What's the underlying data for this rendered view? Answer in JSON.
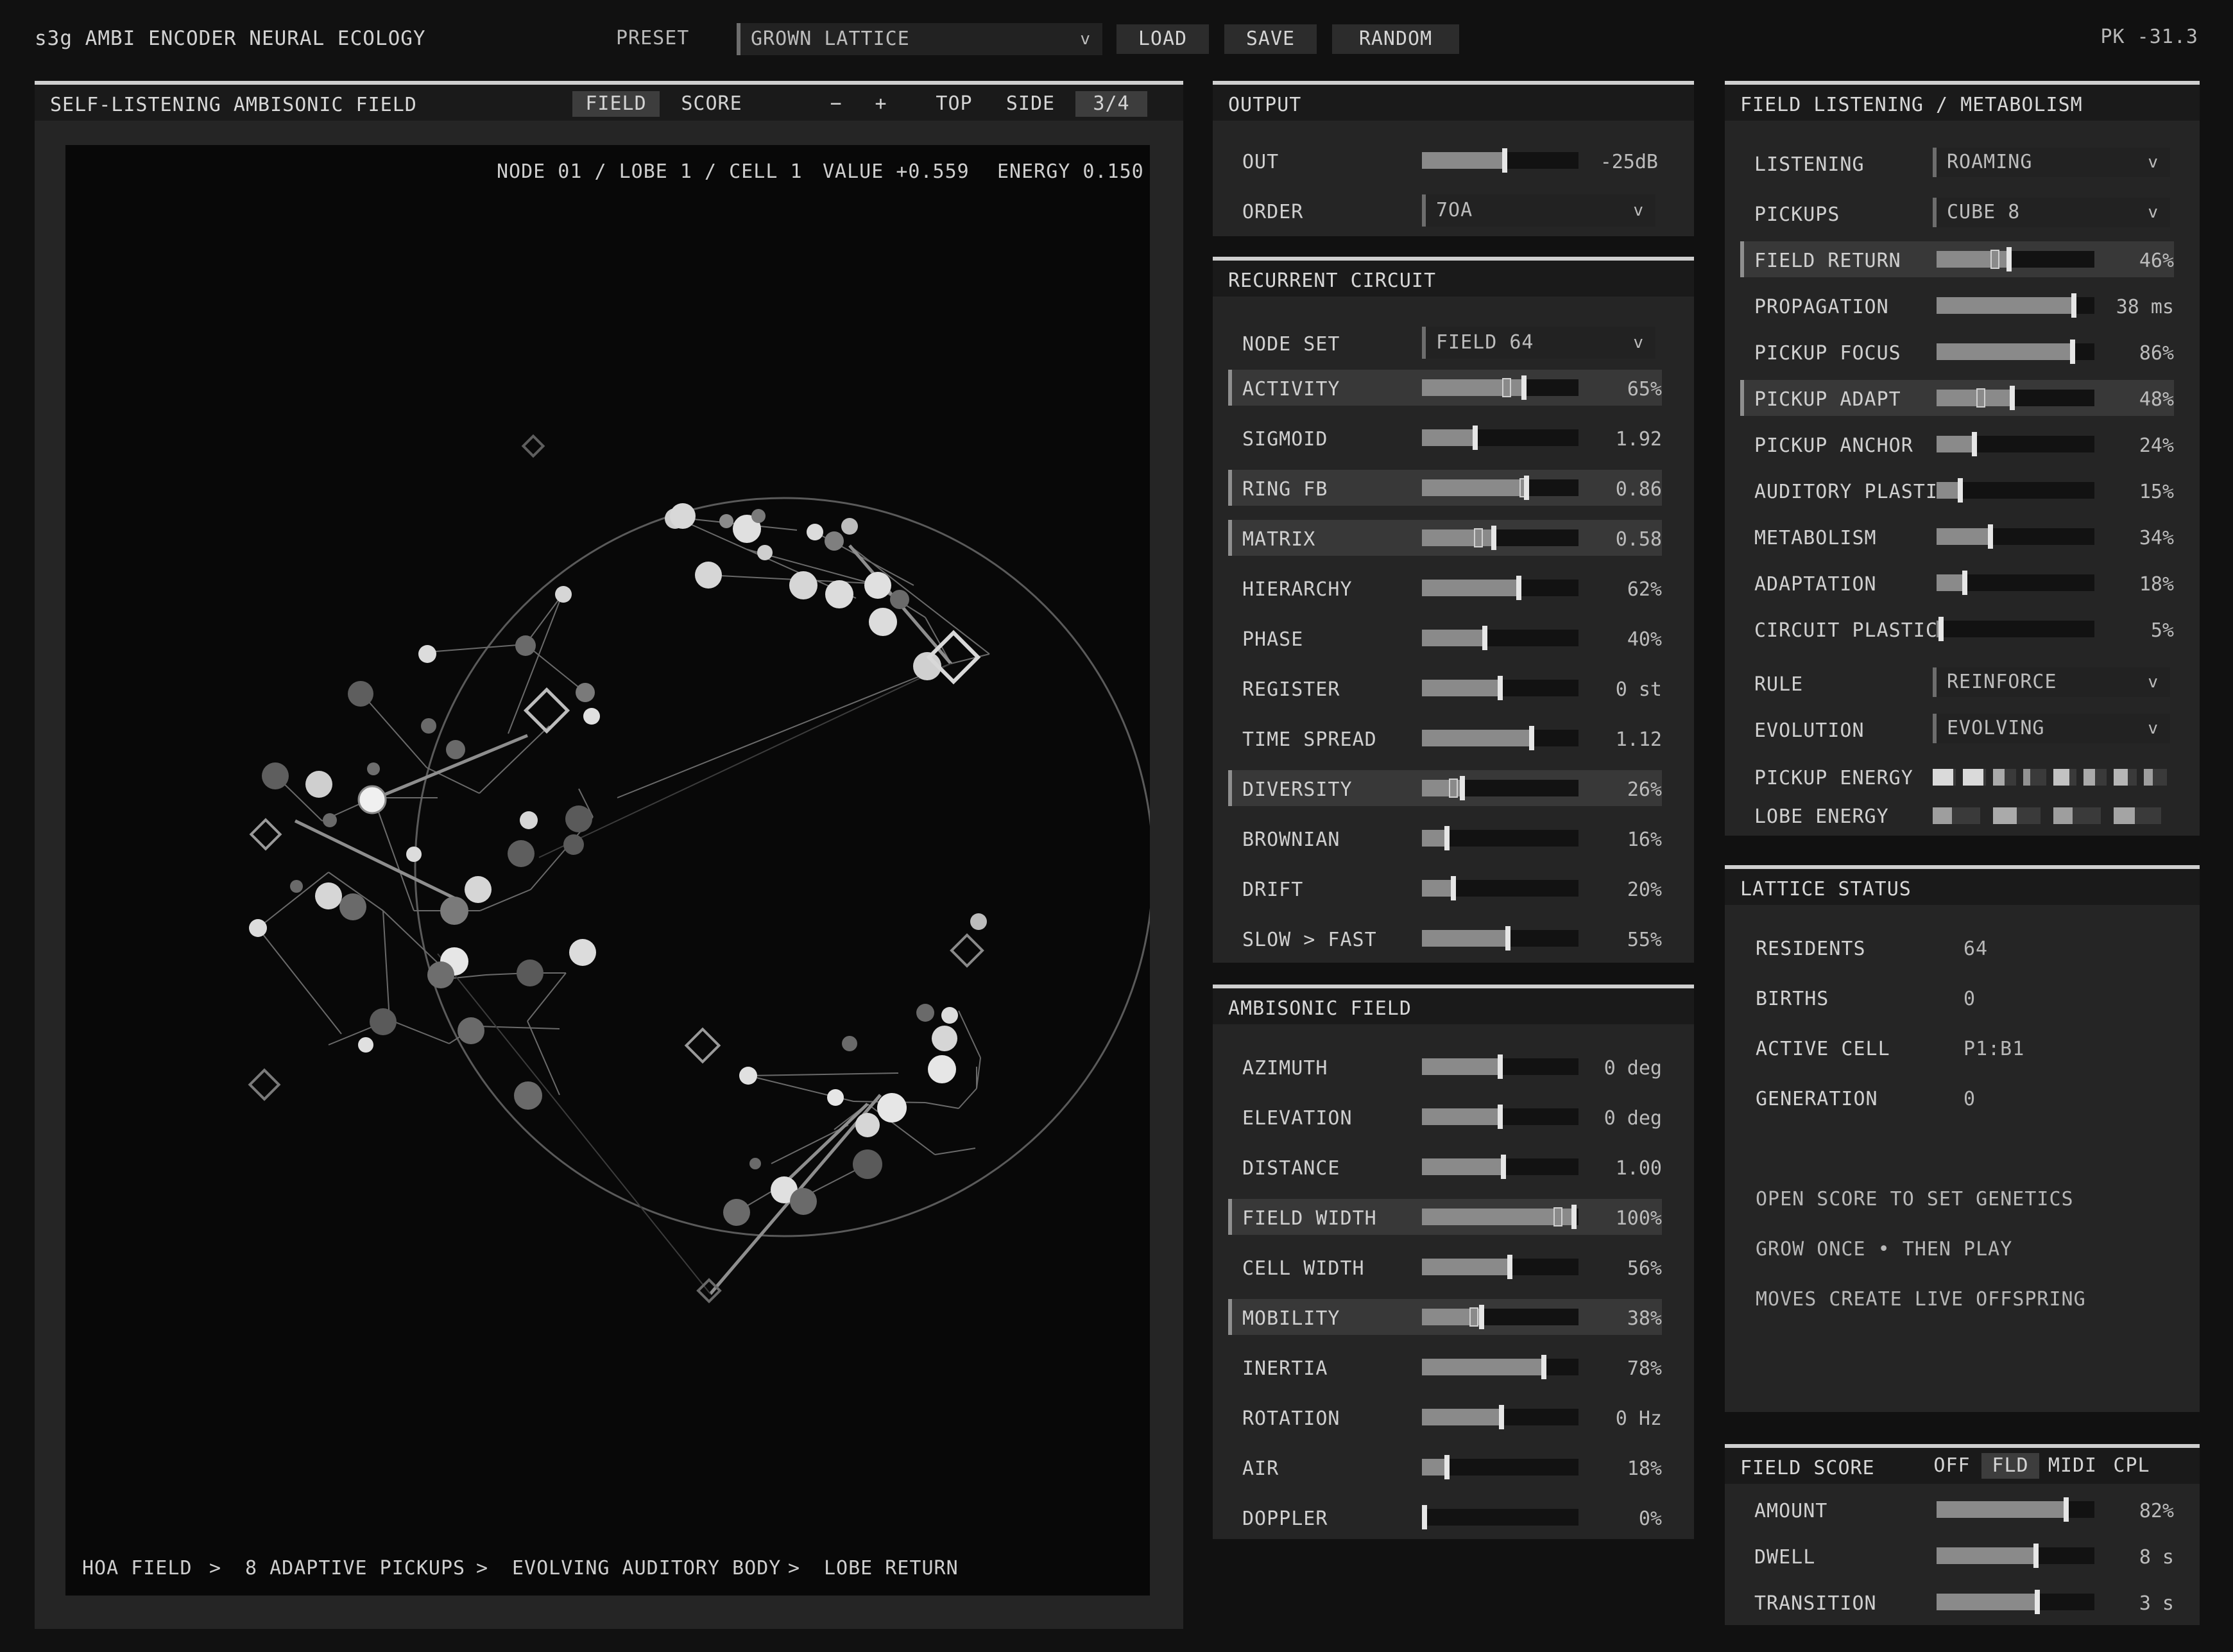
{
  "app": {
    "title": "s3g AMBI ENCODER NEURAL ECOLOGY",
    "peak_readout": "PK -31.3"
  },
  "preset": {
    "label": "PRESET",
    "value": "GROWN LATTICE",
    "load": "LOAD",
    "save": "SAVE",
    "random": "RANDOM"
  },
  "field_view": {
    "title": "SELF-LISTENING AMBISONIC FIELD",
    "tabs": [
      "FIELD",
      "SCORE"
    ],
    "active_tab": "FIELD",
    "zoom_out": "−",
    "zoom_in": "+",
    "views": [
      "TOP",
      "SIDE"
    ],
    "perspective": "3/4",
    "readout": {
      "node": "NODE 01 / LOBE 1 / CELL 1",
      "value": "VALUE +0.559",
      "energy": "ENERGY 0.150"
    },
    "pipeline": [
      "HOA FIELD",
      ">",
      "8 ADAPTIVE PICKUPS",
      ">",
      "EVOLVING AUDITORY BODY",
      ">",
      "LOBE RETURN"
    ]
  },
  "output": {
    "title": "OUTPUT",
    "out": {
      "label": "OUT",
      "value": "-25dB",
      "level": 0.53
    },
    "order": {
      "label": "ORDER",
      "value": "7OA"
    }
  },
  "recurrent": {
    "title": "RECURRENT CIRCUIT",
    "node_set": {
      "label": "NODE SET",
      "value": "FIELD 64"
    },
    "params": [
      {
        "label": "ACTIVITY",
        "value": "65%",
        "level": 0.65,
        "hl": true,
        "ghost": 0.54
      },
      {
        "label": "SIGMOID",
        "value": "1.92",
        "level": 0.34,
        "hl": false
      },
      {
        "label": "RING FB",
        "value": "0.86",
        "level": 0.67,
        "hl": true,
        "ghost": 0.65
      },
      {
        "label": "MATRIX",
        "value": "0.58",
        "level": 0.46,
        "hl": true,
        "ghost": 0.36
      },
      {
        "label": "HIERARCHY",
        "value": "62%",
        "level": 0.62,
        "hl": false
      },
      {
        "label": "PHASE",
        "value": "40%",
        "level": 0.4,
        "hl": false
      },
      {
        "label": "REGISTER",
        "value": "0 st",
        "level": 0.5,
        "hl": false
      },
      {
        "label": "TIME SPREAD",
        "value": "1.12",
        "level": 0.7,
        "hl": false
      },
      {
        "label": "DIVERSITY",
        "value": "26%",
        "level": 0.26,
        "hl": true,
        "ghost": 0.2
      },
      {
        "label": "BROWNIAN",
        "value": "16%",
        "level": 0.16,
        "hl": false
      },
      {
        "label": "DRIFT",
        "value": "20%",
        "level": 0.2,
        "hl": false
      },
      {
        "label": "SLOW > FAST",
        "value": "55%",
        "level": 0.55,
        "hl": false
      }
    ]
  },
  "ambisonic": {
    "title": "AMBISONIC FIELD",
    "params": [
      {
        "label": "AZIMUTH",
        "value": "0 deg",
        "level": 0.5,
        "hl": false
      },
      {
        "label": "ELEVATION",
        "value": "0 deg",
        "level": 0.5,
        "hl": false
      },
      {
        "label": "DISTANCE",
        "value": "1.00",
        "level": 0.52,
        "hl": false
      },
      {
        "label": "FIELD WIDTH",
        "value": "100%",
        "level": 0.97,
        "hl": true,
        "ghost": 0.87
      },
      {
        "label": "CELL WIDTH",
        "value": "56%",
        "level": 0.56,
        "hl": false
      },
      {
        "label": "MOBILITY",
        "value": "38%",
        "level": 0.38,
        "hl": true,
        "ghost": 0.33
      },
      {
        "label": "INERTIA",
        "value": "78%",
        "level": 0.78,
        "hl": false
      },
      {
        "label": "ROTATION",
        "value": "0 Hz",
        "level": 0.51,
        "hl": false
      },
      {
        "label": "AIR",
        "value": "18%",
        "level": 0.16,
        "hl": false
      },
      {
        "label": "DOPPLER",
        "value": "0%",
        "level": 0.0,
        "hl": false
      }
    ]
  },
  "listening": {
    "title": "FIELD LISTENING / METABOLISM",
    "listening": {
      "label": "LISTENING",
      "value": "ROAMING"
    },
    "pickups": {
      "label": "PICKUPS",
      "value": "CUBE 8"
    },
    "params": [
      {
        "label": "FIELD RETURN",
        "value": "46%",
        "level": 0.46,
        "hl": true,
        "ghost": 0.37
      },
      {
        "label": "PROPAGATION",
        "value": "38 ms",
        "level": 0.87,
        "hl": false
      },
      {
        "label": "PICKUP FOCUS",
        "value": "86%",
        "level": 0.86,
        "hl": false
      },
      {
        "label": "PICKUP ADAPT",
        "value": "48%",
        "level": 0.48,
        "hl": true,
        "ghost": 0.28
      },
      {
        "label": "PICKUP ANCHOR",
        "value": "24%",
        "level": 0.24,
        "hl": false
      },
      {
        "label": "AUDITORY PLASTIC",
        "value": "15%",
        "level": 0.15,
        "hl": false
      },
      {
        "label": "METABOLISM",
        "value": "34%",
        "level": 0.34,
        "hl": false
      },
      {
        "label": "ADAPTATION",
        "value": "18%",
        "level": 0.18,
        "hl": false
      },
      {
        "label": "CIRCUIT PLASTIC",
        "value": "5%",
        "level": 0.03,
        "hl": false
      }
    ],
    "rule": {
      "label": "RULE",
      "value": "REINFORCE"
    },
    "evolution": {
      "label": "EVOLUTION",
      "value": "EVOLVING"
    },
    "pickup_energy": {
      "label": "PICKUP ENERGY",
      "levels": [
        0.9,
        0.9,
        0.5,
        0.3,
        0.7,
        0.5,
        0.6,
        0.4
      ]
    },
    "lobe_energy": {
      "label": "LOBE ENERGY",
      "levels": [
        0.4,
        0.5,
        0.4,
        0.45
      ]
    }
  },
  "lattice": {
    "title": "LATTICE STATUS",
    "stats": [
      {
        "label": "RESIDENTS",
        "value": "64"
      },
      {
        "label": "BIRTHS",
        "value": "0"
      },
      {
        "label": "ACTIVE CELL",
        "value": "P1:B1"
      },
      {
        "label": "GENERATION",
        "value": "0"
      }
    ],
    "hints": [
      "OPEN SCORE TO SET GENETICS",
      "GROW ONCE • THEN PLAY",
      "MOVES CREATE LIVE OFFSPRING"
    ]
  },
  "score": {
    "title": "FIELD SCORE",
    "modes": [
      "OFF",
      "FLD",
      "MIDI",
      "CPL"
    ],
    "active_mode": "FLD",
    "params": [
      {
        "label": "AMOUNT",
        "value": "82%",
        "level": 0.82
      },
      {
        "label": "DWELL",
        "value": "8 s",
        "level": 0.63
      },
      {
        "label": "TRANSITION",
        "value": "3 s",
        "level": 0.64
      }
    ]
  }
}
